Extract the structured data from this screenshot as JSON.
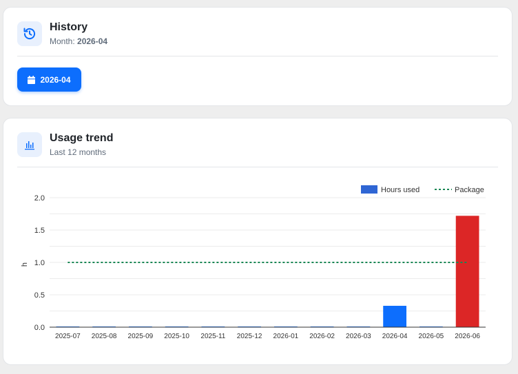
{
  "history": {
    "title": "History",
    "month_label": "Month:",
    "month_value": "2026-04",
    "button_label": "2026-04"
  },
  "trend": {
    "title": "Usage trend",
    "subtitle": "Last 12 months"
  },
  "colors": {
    "accent": "#0d6efd",
    "bar_default": "#0d6efd",
    "bar_over": "#dc2626",
    "package_line": "#198754",
    "legend_hours": "#2f66d4"
  },
  "chart_data": {
    "type": "bar",
    "categories": [
      "2025-07",
      "2025-08",
      "2025-09",
      "2025-10",
      "2025-11",
      "2025-12",
      "2026-01",
      "2026-02",
      "2026-03",
      "2026-04",
      "2026-05",
      "2026-06"
    ],
    "series": [
      {
        "name": "Hours used",
        "values": [
          0.01,
          0.01,
          0.01,
          0.01,
          0.01,
          0.01,
          0.01,
          0.01,
          0.01,
          0.33,
          0.01,
          1.72
        ]
      },
      {
        "name": "Package",
        "type": "line",
        "style": "dotted",
        "values": [
          1,
          1,
          1,
          1,
          1,
          1,
          1,
          1,
          1,
          1,
          1,
          1
        ]
      }
    ],
    "ylabel": "h",
    "ylim": [
      0,
      2
    ],
    "yticks": [
      "0.0",
      "0.5",
      "1.0",
      "1.5",
      "2.0"
    ],
    "legend_position": "top-right",
    "grid": true
  }
}
